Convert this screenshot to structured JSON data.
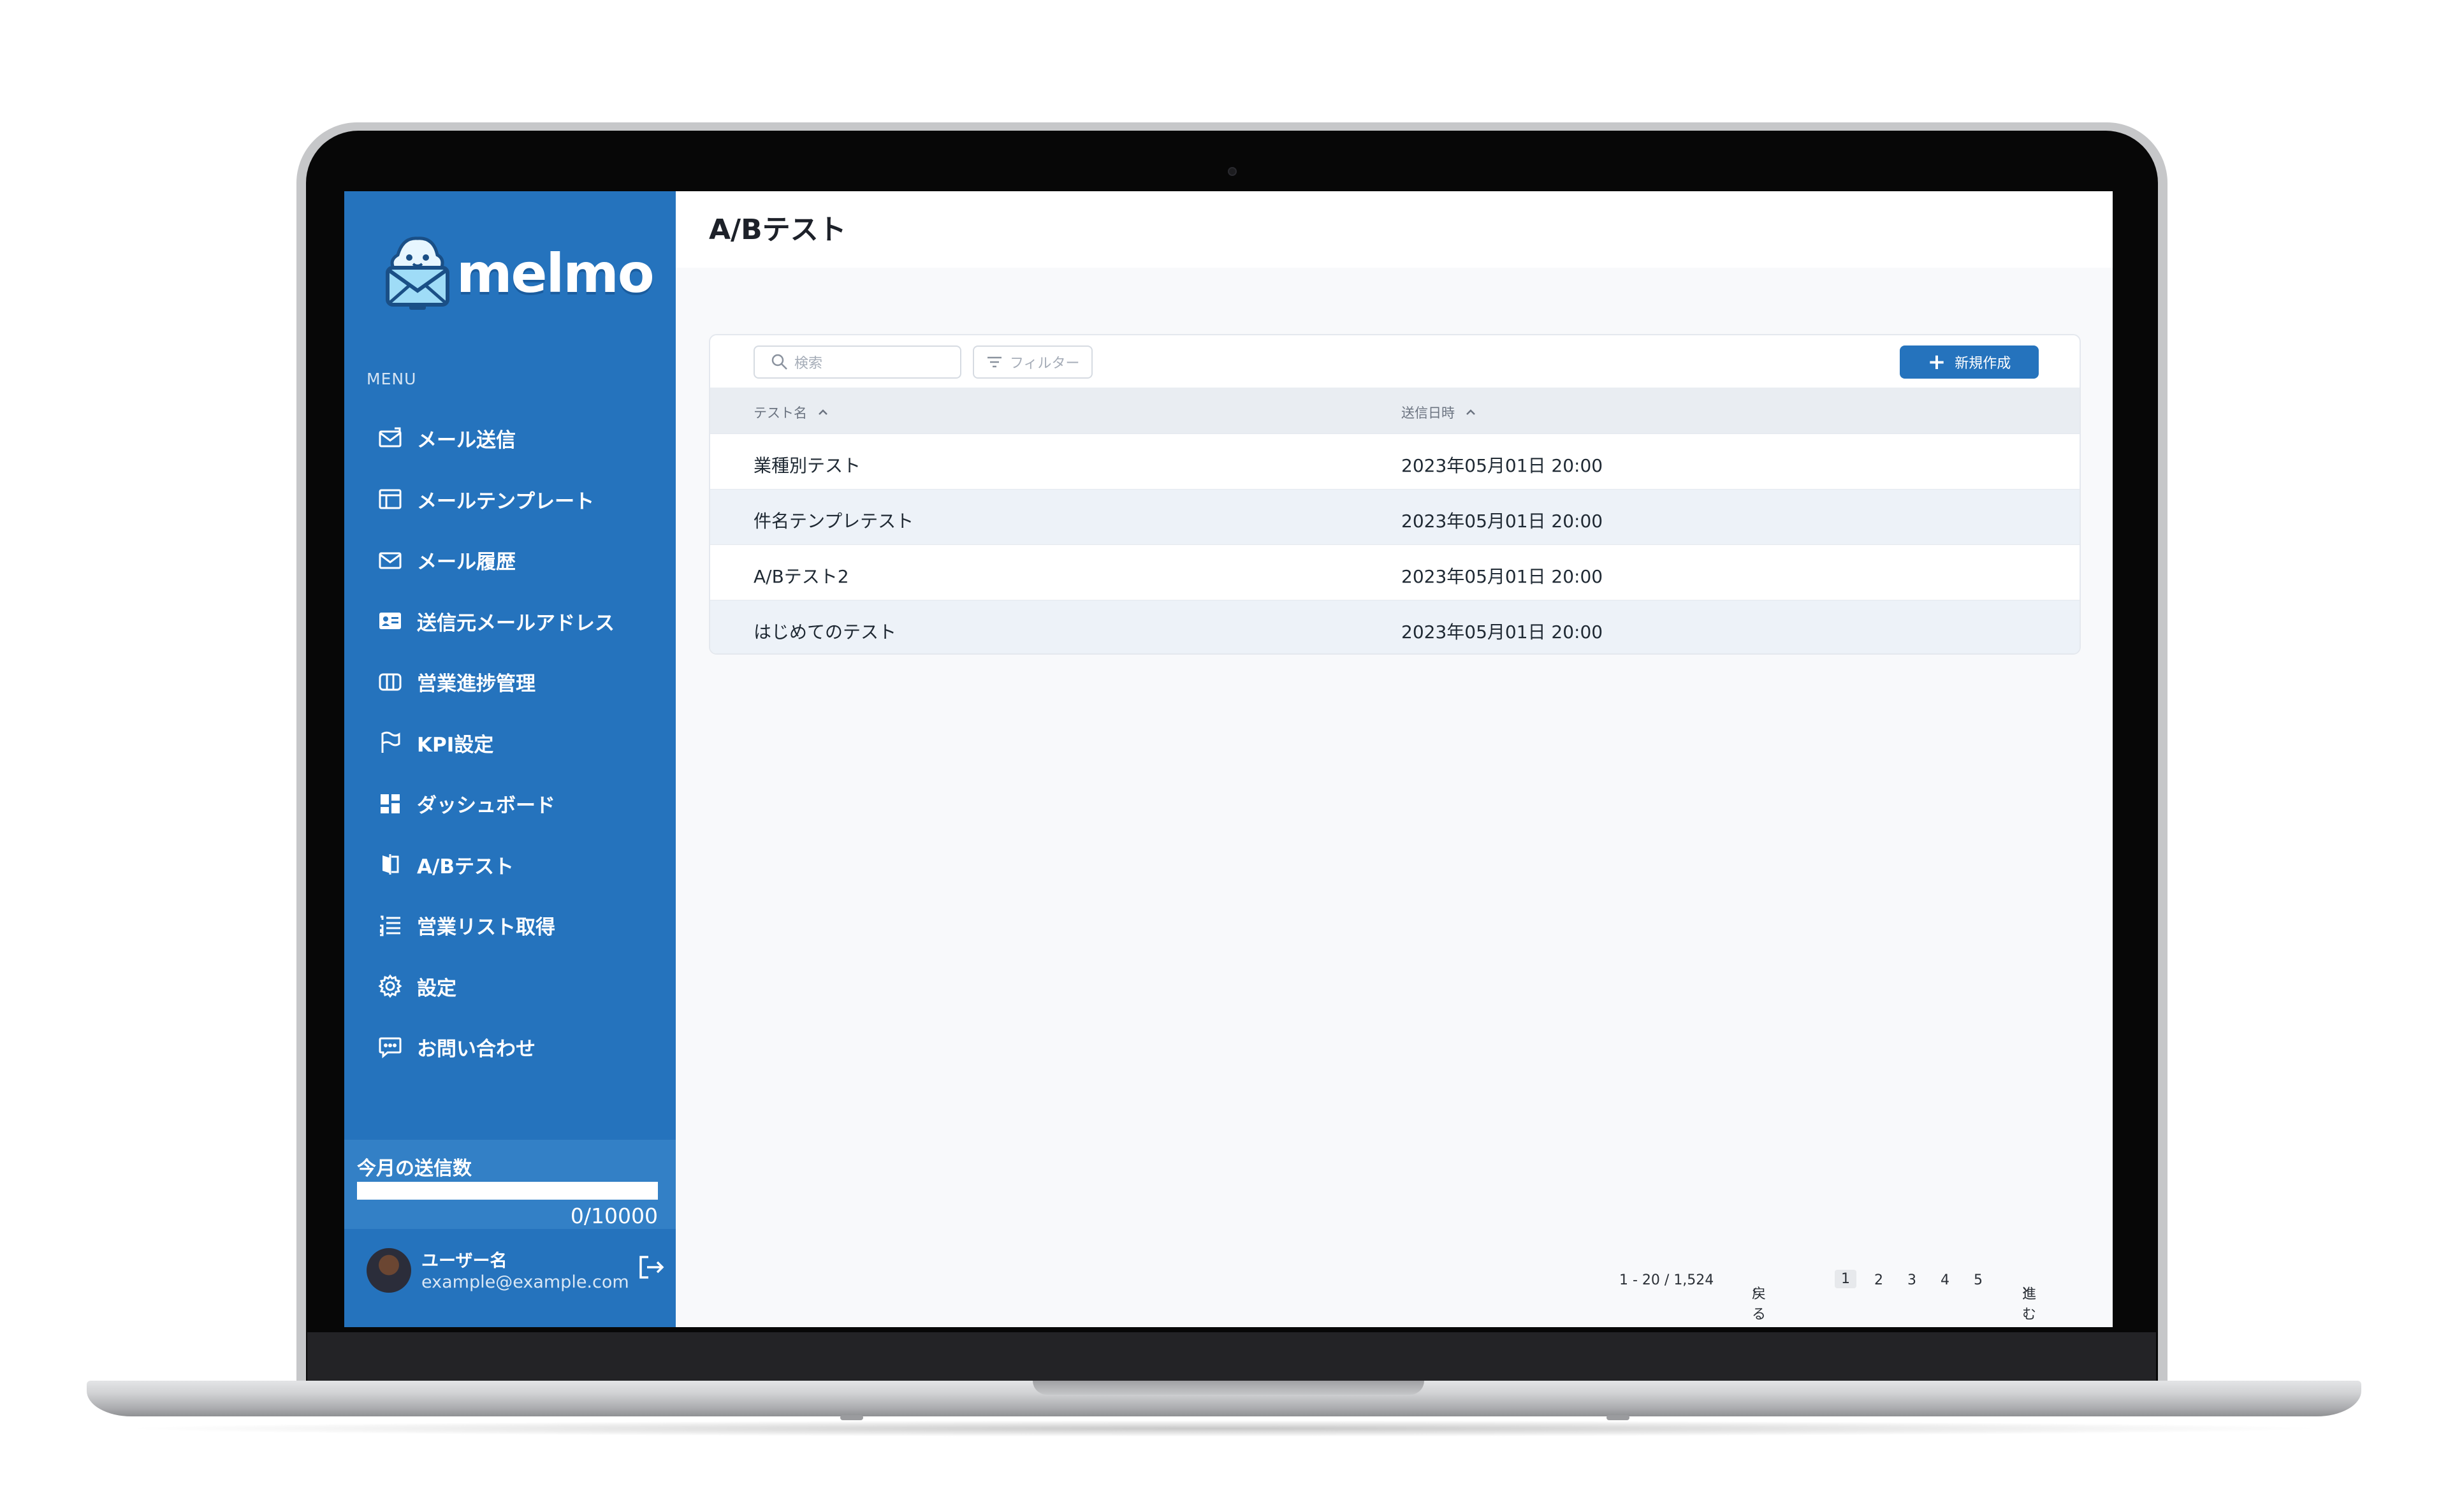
{
  "app": {
    "logo_text": "melmo",
    "page_title": "A/Bテスト"
  },
  "sidebar": {
    "menu_heading": "MENU",
    "items": [
      {
        "label": "メール送信",
        "icon": "mail-send-icon"
      },
      {
        "label": "メールテンプレート",
        "icon": "template-icon"
      },
      {
        "label": "メール履歴",
        "icon": "mail-icon"
      },
      {
        "label": "送信元メールアドレス",
        "icon": "id-card-icon"
      },
      {
        "label": "営業進捗管理",
        "icon": "kanban-icon"
      },
      {
        "label": "KPI設定",
        "icon": "flag-icon"
      },
      {
        "label": "ダッシュボード",
        "icon": "dashboard-icon"
      },
      {
        "label": "A/Bテスト",
        "icon": "ab-test-icon"
      },
      {
        "label": "営業リスト取得",
        "icon": "list-icon"
      },
      {
        "label": "設定",
        "icon": "gear-icon"
      },
      {
        "label": "お問い合わせ",
        "icon": "chat-icon"
      }
    ],
    "usage": {
      "title": "今月の送信数",
      "count": "0/10000",
      "progress": 0
    },
    "user": {
      "name": "ユーザー名",
      "email": "example@example.com"
    }
  },
  "toolbar": {
    "search_placeholder": "検索",
    "filter_label": "フィルター",
    "new_button": "新規作成"
  },
  "table": {
    "columns": [
      "テスト名",
      "送信日時"
    ],
    "rows": [
      {
        "name": "業種別テスト",
        "sent_at": "2023年05月01日 20:00"
      },
      {
        "name": "件名テンプレテスト",
        "sent_at": "2023年05月01日 20:00"
      },
      {
        "name": "A/Bテスト2",
        "sent_at": "2023年05月01日 20:00"
      },
      {
        "name": "はじめてのテスト",
        "sent_at": "2023年05月01日 20:00"
      }
    ]
  },
  "pagination": {
    "range": "1 - 20 / 1,524",
    "prev": "戻る",
    "next": "進む",
    "pages": [
      "1",
      "2",
      "3",
      "4",
      "5"
    ],
    "current": "1"
  },
  "colors": {
    "sidebar": "#2573bd",
    "accent": "#2573bd",
    "table_header": "#e9edf2",
    "row_alt": "#edf2f8"
  }
}
